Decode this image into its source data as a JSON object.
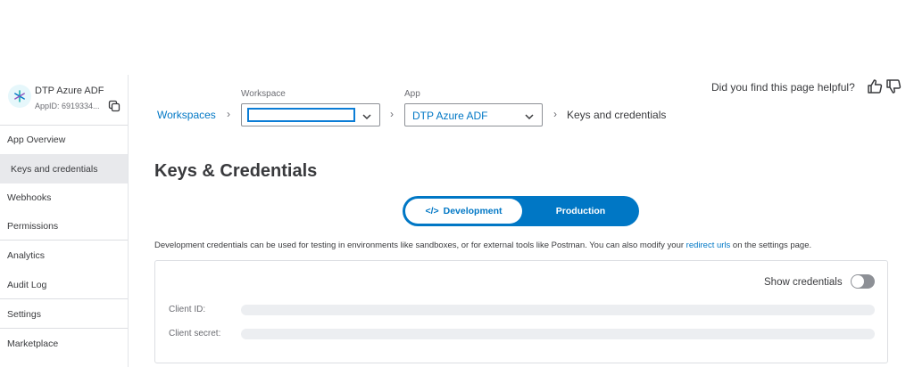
{
  "sidebar": {
    "app_name": "DTP Azure ADF",
    "app_id": "AppID: 6919334...",
    "items": [
      {
        "label": "App Overview"
      },
      {
        "label": "Keys and credentials"
      },
      {
        "label": "Webhooks"
      },
      {
        "label": "Permissions"
      },
      {
        "label": "Analytics"
      },
      {
        "label": "Audit Log"
      },
      {
        "label": "Settings"
      },
      {
        "label": "Marketplace"
      }
    ],
    "active_item": "Keys and credentials"
  },
  "feedback": {
    "question": "Did you find this page helpful?"
  },
  "breadcrumb": {
    "workspaces_link": "Workspaces",
    "workspace_label": "Workspace",
    "workspace_value": "",
    "app_label": "App",
    "app_value": "DTP Azure ADF",
    "current": "Keys and credentials"
  },
  "page": {
    "title": "Keys & Credentials"
  },
  "environment": {
    "development_label": "Development",
    "production_label": "Production",
    "selected": "Development"
  },
  "description": {
    "text_before": "Development credentials can be used for testing in environments like sandboxes, or for external tools like Postman. You can also modify your ",
    "link": "redirect urls",
    "text_after": " on the settings page."
  },
  "credentials": {
    "show_label": "Show credentials",
    "show_enabled": false,
    "client_id_label": "Client ID:",
    "client_secret_label": "Client secret:"
  },
  "colors": {
    "accent": "#0077c5",
    "text": "#393a3d",
    "active_nav_bg": "#e8e9ec"
  }
}
